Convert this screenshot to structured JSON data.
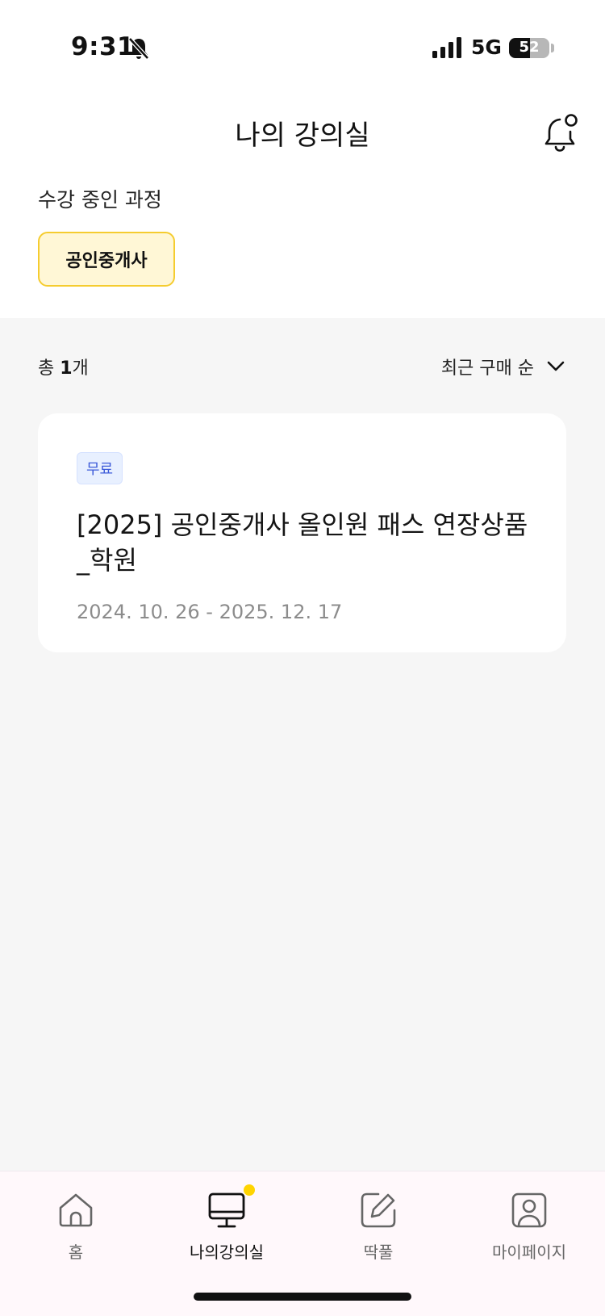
{
  "status_bar": {
    "time": "9:31",
    "network": "5G",
    "battery": "52",
    "battery_level": 0.52
  },
  "header": {
    "title": "나의 강의실"
  },
  "courses_section": {
    "label": "수강 중인 과정",
    "category_chip": "공인중개사"
  },
  "list": {
    "count_prefix": "총 ",
    "count_value": "1",
    "count_suffix": "개",
    "sort_label": "최근 구매 순",
    "items": [
      {
        "badge": "무료",
        "title": "[2025] 공인중개사 올인원 패스 연장상품_학원",
        "period": "2024. 10. 26 - 2025. 12. 17"
      }
    ]
  },
  "bottom_nav": {
    "items": [
      {
        "label": "홈",
        "icon": "home-icon",
        "active": false
      },
      {
        "label": "나의강의실",
        "icon": "monitor-icon",
        "active": true
      },
      {
        "label": "딱풀",
        "icon": "edit-icon",
        "active": false
      },
      {
        "label": "마이페이지",
        "icon": "profile-icon",
        "active": false
      }
    ]
  },
  "colors": {
    "accent_yellow": "#ffd400",
    "chip_background": "#fff7d6",
    "chip_border": "#f5cc2f",
    "badge_text": "#3d5bd9",
    "content_background": "#f6f6f6"
  }
}
